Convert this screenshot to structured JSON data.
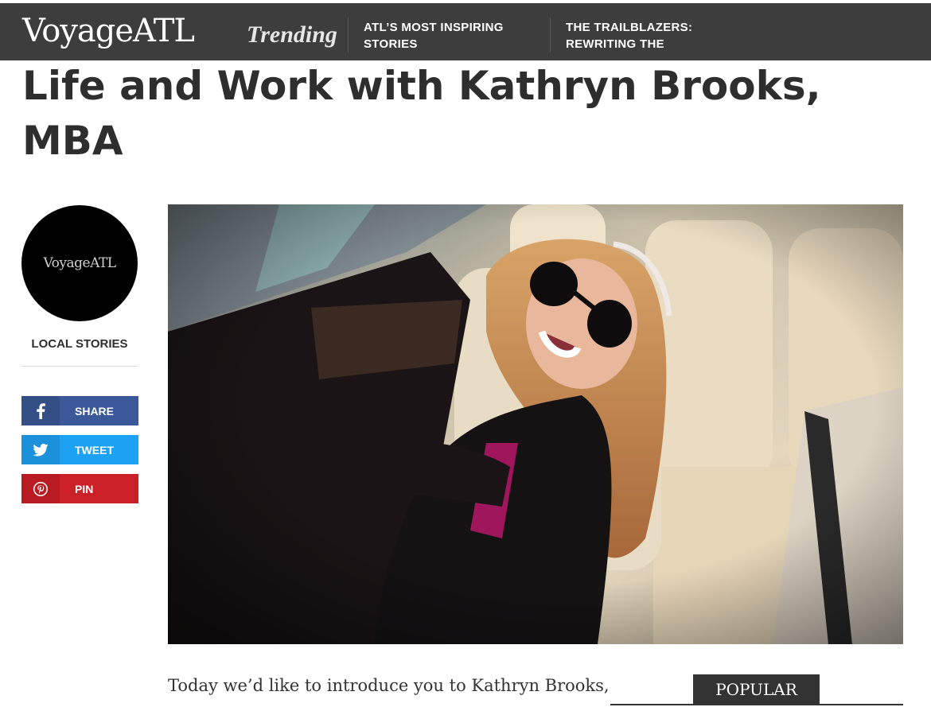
{
  "header": {
    "logo": "VoyageATL",
    "trending_label": "Trending",
    "trending_links": [
      {
        "label": "ATL’S MOST INSPIRING STORIES"
      },
      {
        "label": "THE TRAILBLAZERS: REWRITING THE"
      }
    ]
  },
  "article": {
    "title": "Life and Work with Kathryn Brooks, MBA",
    "intro": "Today we’d like to introduce you to Kathryn Brooks,"
  },
  "author": {
    "avatar_text": "VoyageATL",
    "category": "LOCAL STORIES"
  },
  "share": {
    "facebook": "SHARE",
    "twitter": "TWEET",
    "pinterest": "PIN"
  },
  "sidebar": {
    "popular": "POPULAR"
  },
  "colors": {
    "topbar": "#3d3d3d",
    "facebook": "#3b5998",
    "twitter": "#1da1f2",
    "pinterest": "#cb2027"
  }
}
